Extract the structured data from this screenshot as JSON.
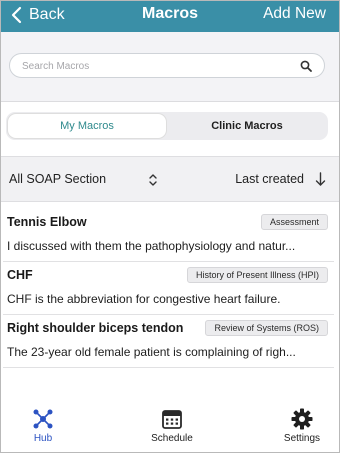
{
  "header": {
    "back_label": "Back",
    "title": "Macros",
    "add_label": "Add New"
  },
  "search": {
    "placeholder": "Search Macros",
    "value": ""
  },
  "segments": {
    "my": "My Macros",
    "clinic": "Clinic Macros",
    "selected": "My Macros"
  },
  "filter": {
    "section_label": "All SOAP Section",
    "sort_label": "Last created"
  },
  "macros": [
    {
      "title": "Tennis Elbow",
      "badge": "Assessment",
      "description": "I discussed with them the pathophysiology and natur..."
    },
    {
      "title": "CHF",
      "badge": "History of Present Illness (HPI)",
      "description": "CHF is the abbreviation for congestive heart failure."
    },
    {
      "title": "Right shoulder biceps tendon",
      "badge": "Review of Systems (ROS)",
      "description": "The 23-year old female patient is complaining of righ..."
    }
  ],
  "tabs": {
    "hub": "Hub",
    "schedule": "Schedule",
    "settings": "Settings",
    "active": "Hub"
  },
  "colors": {
    "header": "#3a8fa7",
    "accent_text": "#2f8a8d",
    "hub_active": "#2c53c2"
  },
  "icons": {
    "back": "chevron-left-icon",
    "search": "magnifier-icon",
    "sort_toggle": "up-down-chevron-icon",
    "sort_direction": "arrow-down-icon",
    "hub": "network-nodes-icon",
    "schedule": "calendar-icon",
    "settings": "gear-icon"
  }
}
